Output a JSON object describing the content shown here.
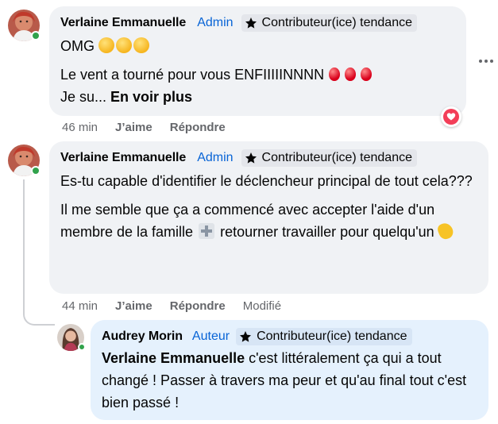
{
  "comments": [
    {
      "author": "Verlaine Emmanuelle",
      "role": "Admin",
      "badge": "Contributeur(ice) tendance",
      "line1": "OMG",
      "line2": "Le vent a tourné pour vous ENFIIIIINNNN",
      "line3_prefix": "Je su...",
      "see_more": "En voir plus",
      "time": "46 min",
      "like": "J’aime",
      "reply": "Répondre",
      "reaction": "heart"
    },
    {
      "author": "Verlaine Emmanuelle",
      "role": "Admin",
      "badge": "Contributeur(ice) tendance",
      "para1": "Es-tu capable d'identifier le déclencheur principal de tout cela???",
      "para2_a": "Il me semble que ça a commencé avec accepter l'aide d'un membre de la famille",
      "para2_b": "retourner travailler pour quelqu'un",
      "time": "44 min",
      "like": "J’aime",
      "reply": "Répondre",
      "edited": "Modifié"
    },
    {
      "author": "Audrey Morin",
      "role": "Auteur",
      "badge": "Contributeur(ice) tendance",
      "mention": "Verlaine Emmanuelle",
      "body": "c'est littéralement ça qui a tout changé ! Passer à travers ma peur et qu'au final tout c'est bien passé !"
    }
  ],
  "icons": {
    "badge": "star-badge-icon",
    "more": "more-options-icon",
    "reaction": "heart-reaction-icon"
  },
  "colors": {
    "bubble": "#f0f2f5",
    "reply_bubble": "#e5f1fd",
    "role": "#0864d6",
    "online": "#31a24c",
    "heart": "#f33e58"
  }
}
